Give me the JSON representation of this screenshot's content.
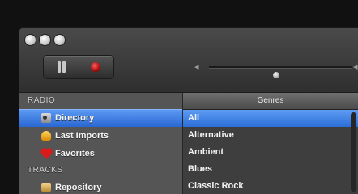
{
  "toolbar": {
    "volume_low_icon": "speaker-low-icon",
    "volume_high_icon": "speaker-high-icon",
    "volume_level_percent": 45
  },
  "sidebar": {
    "sections": [
      {
        "title": "RADIO",
        "items": [
          {
            "label": "Directory",
            "icon": "radio-icon"
          },
          {
            "label": "Last Imports",
            "icon": "import-icon"
          },
          {
            "label": "Favorites",
            "icon": "heart-icon"
          }
        ]
      },
      {
        "title": "TRACKS",
        "items": [
          {
            "label": "Repository",
            "icon": "repository-icon"
          }
        ]
      }
    ],
    "selected_item": "Directory"
  },
  "genres": {
    "header": "Genres",
    "items": [
      "All",
      "Alternative",
      "Ambient",
      "Blues",
      "Classic Rock"
    ],
    "selected": "All"
  },
  "colors": {
    "selection_blue": "#2f6fd5",
    "sidebar_bg": "#555555",
    "genres_bg": "#3e3e3e",
    "record_red": "#c31515"
  }
}
